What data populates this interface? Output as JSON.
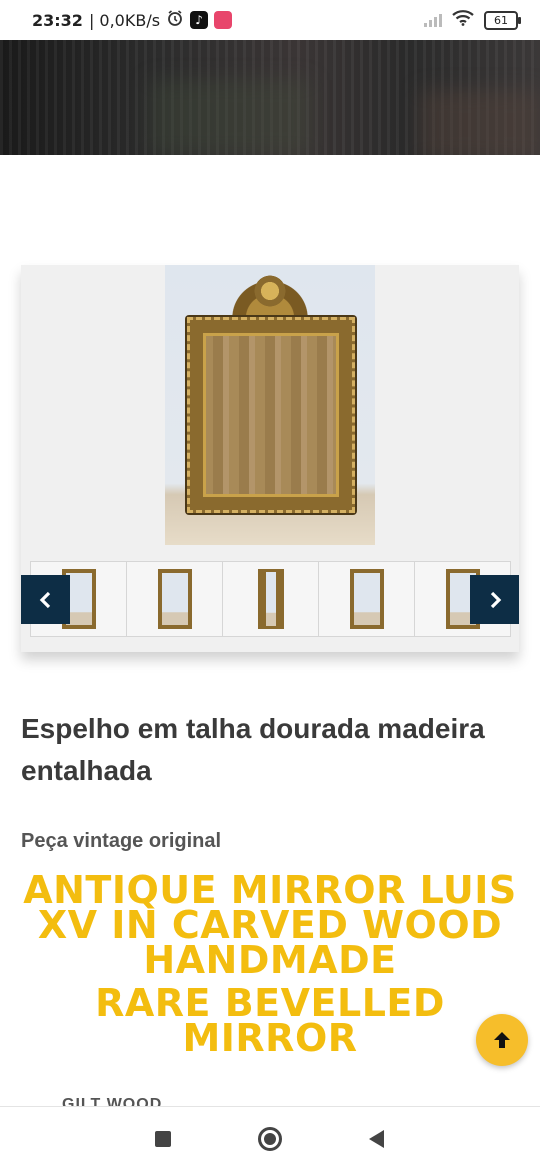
{
  "status_bar": {
    "time": "23:32",
    "network_speed": "| 0,0KB/s",
    "battery": "61",
    "icons": [
      "alarm-icon",
      "tiktok-icon",
      "app-icon",
      "signal-icon",
      "wifi-icon",
      "battery-icon"
    ]
  },
  "gallery": {
    "main_image": "gilded-mirror-photo",
    "thumbnails": [
      "thumb-1",
      "thumb-2",
      "thumb-3",
      "thumb-4",
      "thumb-5"
    ],
    "prev_icon": "chevron-left-icon",
    "next_icon": "chevron-right-icon"
  },
  "product": {
    "title": "Espelho em talha dourada madeira entalhada",
    "subtitle": "Peça vintage original",
    "promo_line_1": "ANTIQUE MIRROR  LUIS XV IN CARVED WOOD HANDMADE",
    "promo_line_2": "RARE BEVELLED MIRROR",
    "cut_text": "GILT WOOD"
  },
  "colors": {
    "promo": "#f3bd0f",
    "arrow_bg": "#0d2d45",
    "scroll_top_bg": "#f6be2b"
  },
  "nav": {
    "icons": [
      "recents-square-icon",
      "home-circle-icon",
      "back-triangle-icon"
    ]
  }
}
